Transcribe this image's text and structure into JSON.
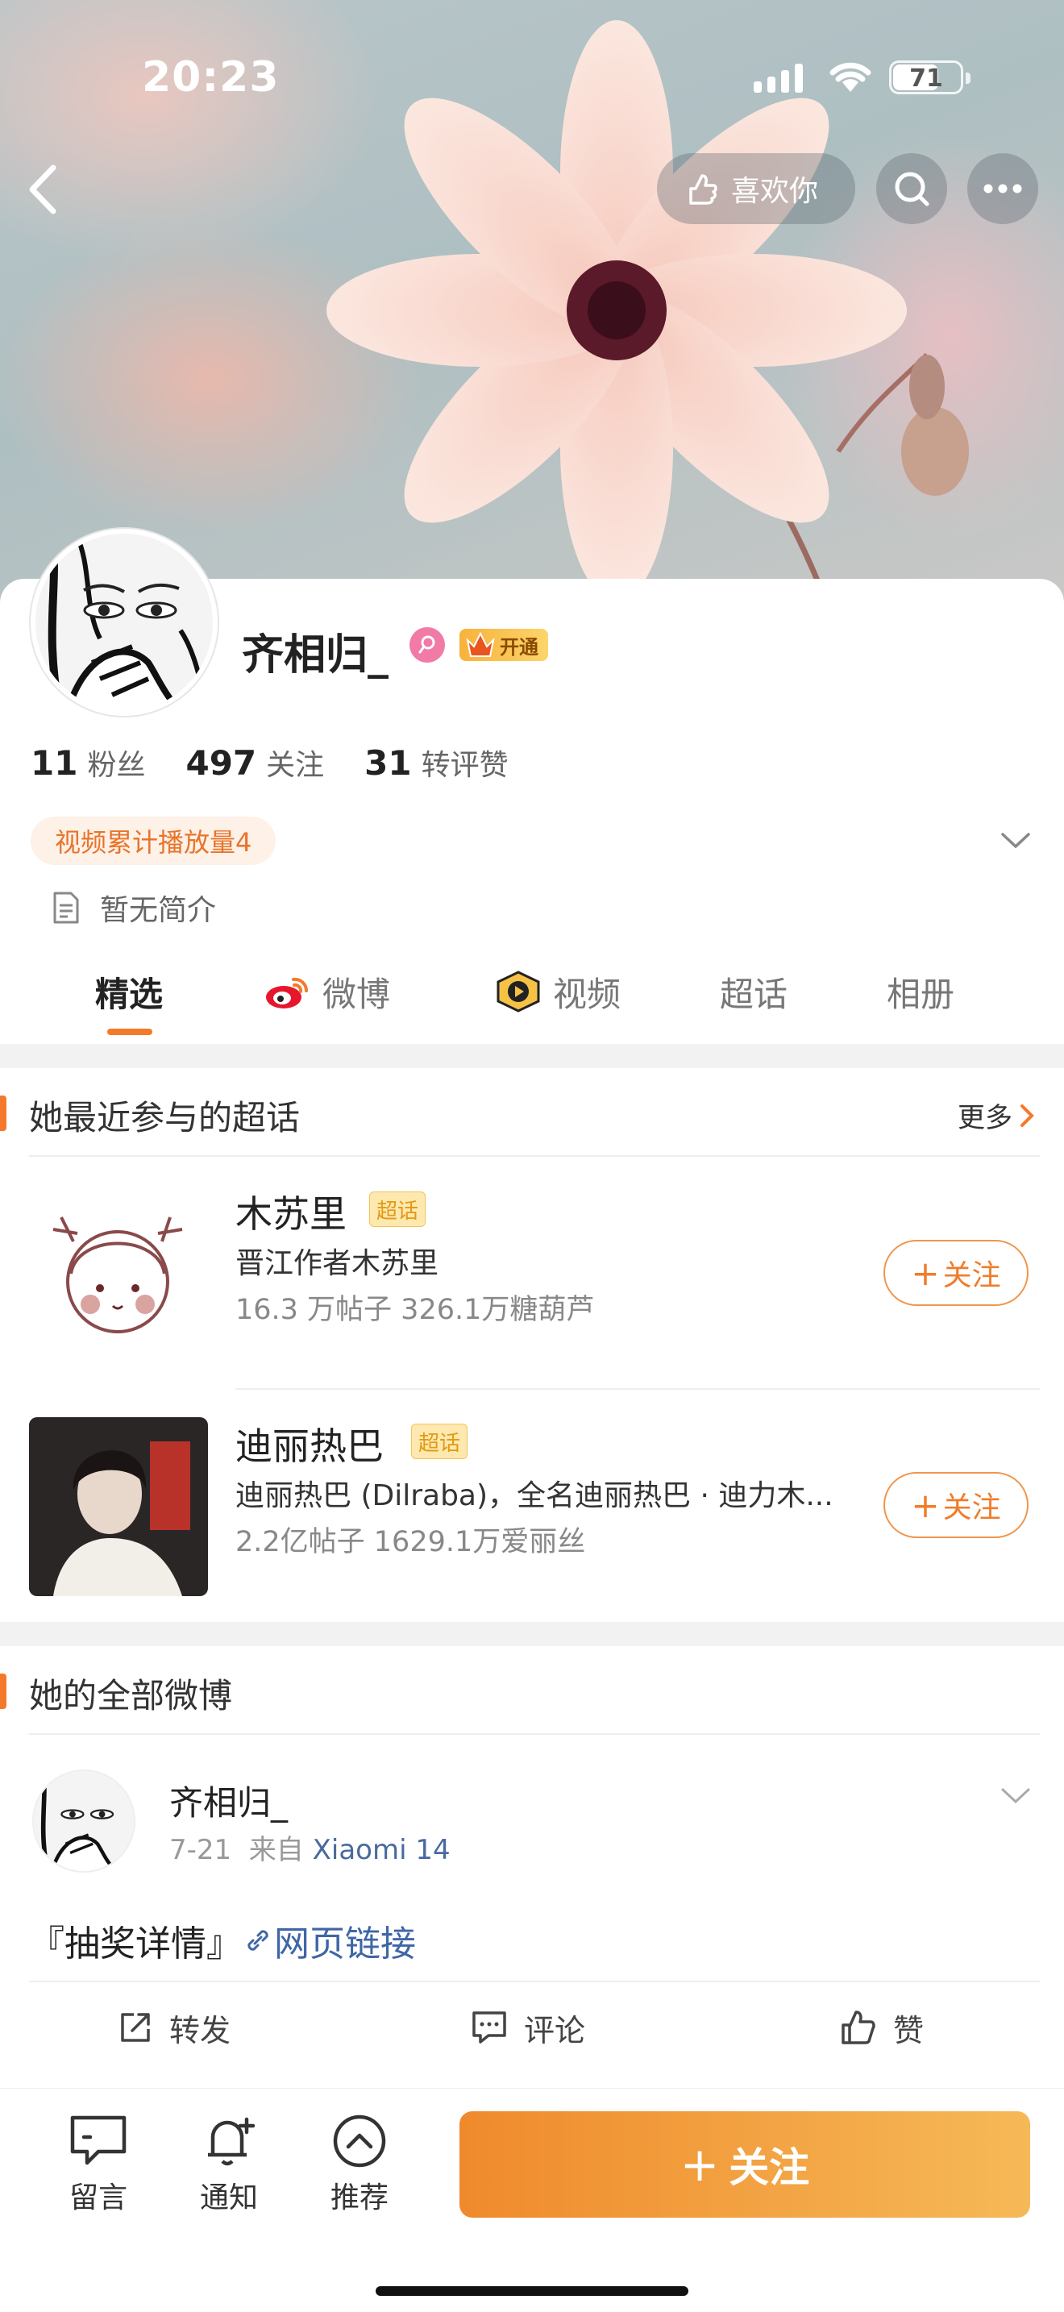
{
  "status_bar": {
    "time": "20:23",
    "battery": "71"
  },
  "header": {
    "like_label": "喜欢你"
  },
  "profile": {
    "name": "齐相归_",
    "vip_label": "开通",
    "stats": [
      {
        "value": "11",
        "label": "粉丝"
      },
      {
        "value": "497",
        "label": "关注"
      },
      {
        "value": "31",
        "label": "转评赞"
      }
    ],
    "tag": "视频累计播放量4",
    "intro": "暂无简介"
  },
  "tabs": [
    {
      "label": "精选",
      "active": true
    },
    {
      "label": "微博"
    },
    {
      "label": "视频"
    },
    {
      "label": "超话"
    },
    {
      "label": "相册"
    }
  ],
  "super_topics": {
    "title": "她最近参与的超话",
    "more": "更多",
    "items": [
      {
        "name": "木苏里",
        "badge": "超话",
        "desc": "晋江作者木苏里",
        "meta": "16.3 万帖子 326.1万糖葫芦",
        "follow": "关注"
      },
      {
        "name": "迪丽热巴",
        "badge": "超话",
        "desc": "迪丽热巴 (Dilraba)，全名迪丽热巴 · 迪力木...",
        "meta": "2.2亿帖子 1629.1万爱丽丝",
        "follow": "关注"
      }
    ]
  },
  "weibo_section": {
    "title": "她的全部微博"
  },
  "post": {
    "author": "齐相归_",
    "date": "7-21",
    "from_label": "来自",
    "source": "Xiaomi 14",
    "text": "『抽奖详情』",
    "link": "网页链接",
    "actions": {
      "repost": "转发",
      "comment": "评论",
      "like": "赞"
    }
  },
  "bottom": {
    "message": "留言",
    "notify": "通知",
    "recommend": "推荐",
    "follow": "关注"
  }
}
